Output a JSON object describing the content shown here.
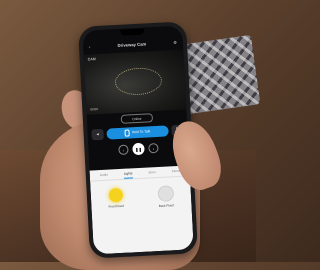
{
  "app": {
    "title": "Driveway Cam",
    "back_icon": "back-arrow-icon",
    "settings_icon": "gear-icon"
  },
  "video": {
    "camera_label": "CAM",
    "timestamp": "00:00"
  },
  "live_chip": "Online",
  "talk": {
    "label": "Hold To Talk",
    "side_label": "Live"
  },
  "controls": [
    "prev-icon",
    "pause-icon",
    "next-icon"
  ],
  "panel": {
    "tabs": [
      "Audio",
      "Lights",
      "Siren",
      "Flood"
    ],
    "active_tab": 1,
    "lights": [
      {
        "label": "Front Flood",
        "state": "on"
      },
      {
        "label": "Back Flood",
        "state": "off"
      }
    ]
  },
  "colors": {
    "accent": "#1a8fe0",
    "light_on": "#f5d21e"
  }
}
